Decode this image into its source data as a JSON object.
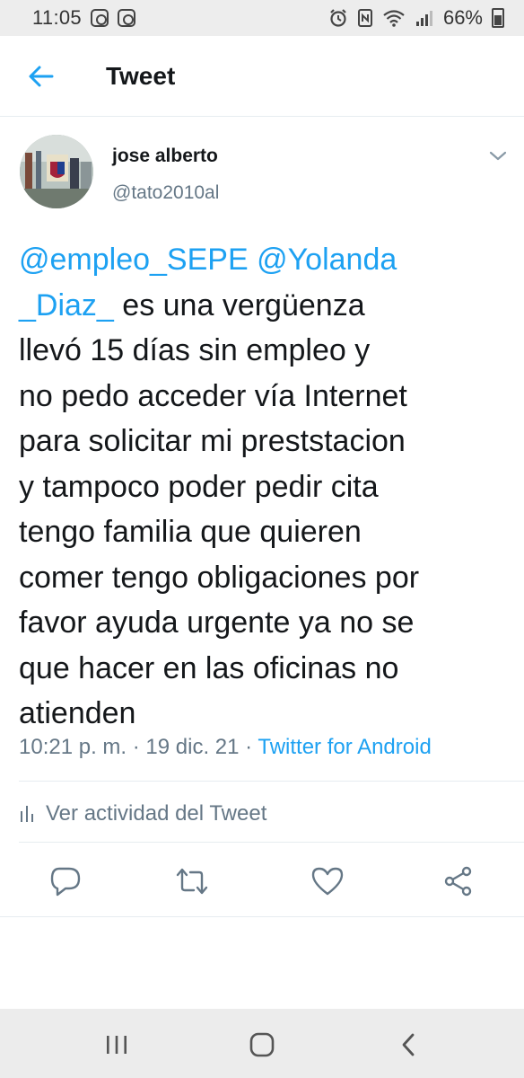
{
  "status_bar": {
    "time": "11:05",
    "battery_percent": "66%",
    "left_icons": [
      "instagram-icon",
      "instagram-icon"
    ],
    "right_icons": [
      "alarm-icon",
      "nfc-icon",
      "wifi-icon",
      "signal-icon",
      "battery-icon"
    ]
  },
  "header": {
    "title": "Tweet",
    "back_icon": "back-arrow-icon"
  },
  "tweet": {
    "author_name": "jose alberto",
    "author_handle": "@tato2010al",
    "mentions": [
      "@empleo_SEPE",
      "@Yolanda",
      "_Diaz_"
    ],
    "text_lines": [
      " es una vergüenza",
      "llevó 15 días sin empleo y",
      "no pedo acceder vía Internet",
      "para solicitar mi preststacion",
      "y tampoco poder pedir cita",
      "tengo familia que quieren",
      "comer tengo obligaciones por",
      "favor ayuda urgente ya no se",
      "que hacer en las oficinas no",
      "atienden"
    ],
    "timestamp": "10:21 p. m. · 19 dic. 21 · ",
    "source": "Twitter for Android"
  },
  "activity": {
    "label": "Ver actividad del Tweet",
    "icon": "analytics-icon"
  },
  "actions": [
    "reply-icon",
    "retweet-icon",
    "like-icon",
    "share-icon"
  ],
  "colors": {
    "accent": "#1da1f2",
    "secondary_text": "#657786",
    "primary_text": "#14171a",
    "divider": "#e6ecf0"
  },
  "nav_bar": [
    "recents-icon",
    "home-icon",
    "back-icon"
  ]
}
